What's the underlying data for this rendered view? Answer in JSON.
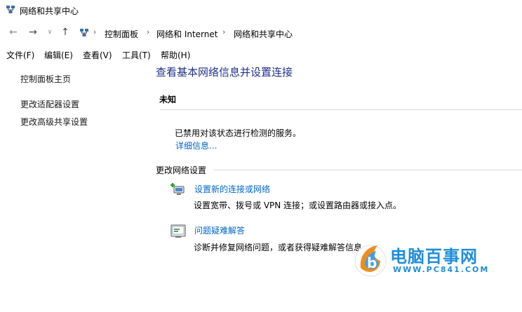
{
  "window": {
    "title": "网络和共享中心"
  },
  "address": {
    "crumbs": [
      "控制面板",
      "网络和 Internet",
      "网络和共享中心"
    ]
  },
  "menu": [
    "文件(F)",
    "编辑(E)",
    "查看(V)",
    "工具(T)",
    "帮助(H)"
  ],
  "sidebar": {
    "home": "控制面板主页",
    "adapter": "更改适配器设置",
    "advanced": "更改高级共享设置"
  },
  "main": {
    "title": "查看基本网络信息并设置连接",
    "network_name": "未知",
    "status": "已禁用对该状态进行检测的服务。",
    "details_link": "详细信息...",
    "change_settings": "更改网络设置",
    "tasks": [
      {
        "link": "设置新的连接或网络",
        "desc": "设置宽带、拨号或 VPN 连接；或设置路由器或接入点。"
      },
      {
        "link": "问题疑难解答",
        "desc": "诊断并修复网络问题，或者获得疑难解答信息。"
      }
    ]
  },
  "watermark": {
    "title": "电脑百事网",
    "url": "WWW.PC841.COM"
  },
  "colors": {
    "title_blue": "#1e3287",
    "link_blue": "#0066cc",
    "watermark_blue": "#1e8ed8"
  }
}
